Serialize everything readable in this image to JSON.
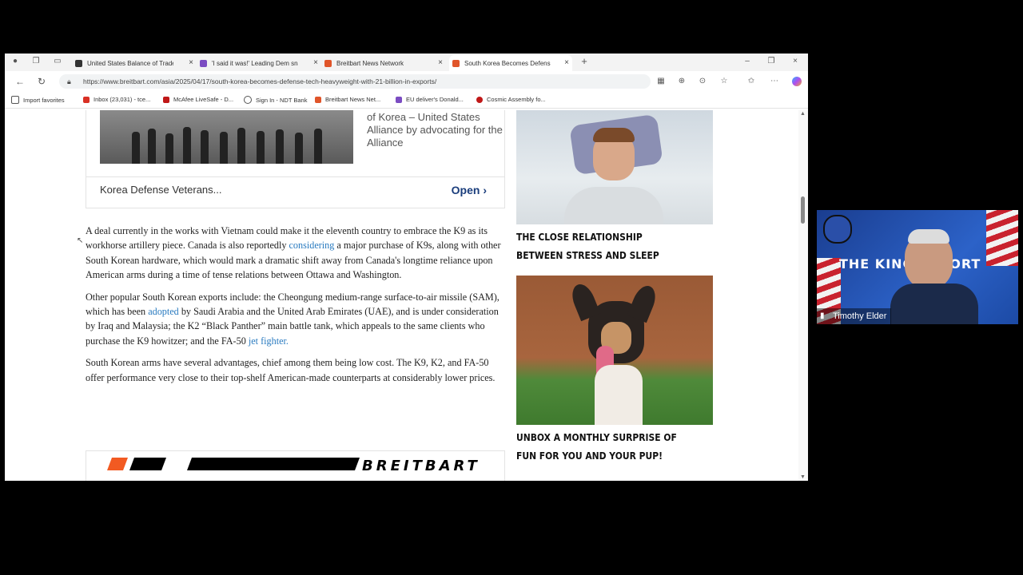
{
  "tabs": [
    {
      "label": "United States Balance of Trade",
      "color": "#333333"
    },
    {
      "label": "'I said it was!' Leading Dem snaps",
      "color": "#7b4cc2"
    },
    {
      "label": "Breitbart News Network",
      "color": "#e0552a"
    },
    {
      "label": "South Korea Becomes Defense Te",
      "color": "#e0552a"
    }
  ],
  "url": "https://www.breitbart.com/asia/2025/04/17/south-korea-becomes-defense-tech-heavyweight-with-21-billion-in-exports/",
  "bookmarks": [
    {
      "label": "Import favorites",
      "color": "#555555"
    },
    {
      "label": "Inbox (23,031) - tce...",
      "color": "#d93025"
    },
    {
      "label": "McAfee LiveSafe - D...",
      "color": "#c01818"
    },
    {
      "label": "Sign In - NDT Bank",
      "color": "#555555"
    },
    {
      "label": "Breitbart News Net...",
      "color": "#e0552a"
    },
    {
      "label": "EU deliver's Donald...",
      "color": "#7b4cc2"
    },
    {
      "label": "Cosmic Assembly fo...",
      "color": "#c01818"
    }
  ],
  "card": {
    "text": "of Korea – United States Alliance by advocating for the Alliance",
    "org": "Korea Defense Veterans...",
    "open": "Open"
  },
  "article": {
    "p1_a": "A deal currently in the works with Vietnam could make it the eleventh country to embrace the K9 as its workhorse artillery piece. Canada is also reportedly ",
    "p1_link": "considering",
    "p1_b": " a major purchase of K9s, along with other South Korean hardware, which would mark a dramatic shift away from Canada's longtime reliance upon American arms during a time of tense relations between Ottawa and Washington.",
    "p2_a": "Other popular South Korean exports include: the Cheongung medium-range surface-to-air missile (SAM), which has been ",
    "p2_link": "adopted",
    "p2_b": " by Saudi Arabia and the United Arab Emirates (UAE), and is under consideration by Iraq and Malaysia; the K2 “Black Panther” main battle tank, which appeals to the same clients who purchase the K9 howitzer; and the FA-50 ",
    "p2_link2": "jet fighter.",
    "p3": "South Korean arms have several advantages, chief among them being low cost. The K9, K2, and FA-50 offer performance very close to their top-shelf American-made counterparts at considerably lower prices."
  },
  "banner": {
    "logo": "BREITBART",
    "accent": "#f25a22"
  },
  "sidebar": {
    "ad1": "THE CLOSE RELATIONSHIP BETWEEN STRESS AND SLEEP",
    "ad2": "UNBOX A MONTHLY SURPRISE OF FUN FOR YOU AND YOUR PUP!"
  },
  "video": {
    "title": "THE KING REPORT",
    "name": "Timothy Elder"
  }
}
